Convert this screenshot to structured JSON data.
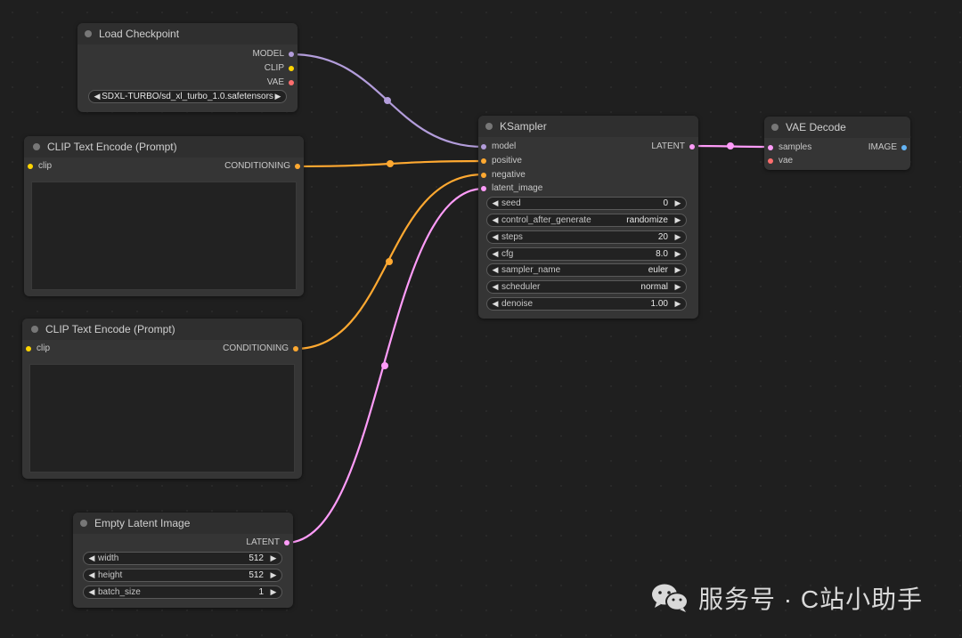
{
  "nodes": {
    "load_checkpoint": {
      "title": "Load Checkpoint",
      "outputs": [
        "MODEL",
        "CLIP",
        "VAE"
      ],
      "ckpt_name": "SDXL-TURBO/sd_xl_turbo_1.0.safetensors"
    },
    "clip_text_encode_1": {
      "title": "CLIP Text Encode (Prompt)",
      "input": "clip",
      "output": "CONDITIONING"
    },
    "clip_text_encode_2": {
      "title": "CLIP Text Encode (Prompt)",
      "input": "clip",
      "output": "CONDITIONING"
    },
    "empty_latent": {
      "title": "Empty Latent Image",
      "output": "LATENT",
      "widgets": [
        {
          "label": "width",
          "value": "512"
        },
        {
          "label": "height",
          "value": "512"
        },
        {
          "label": "batch_size",
          "value": "1"
        }
      ]
    },
    "ksampler": {
      "title": "KSampler",
      "inputs": [
        "model",
        "positive",
        "negative",
        "latent_image"
      ],
      "output": "LATENT",
      "widgets": [
        {
          "label": "seed",
          "value": "0"
        },
        {
          "label": "control_after_generate",
          "value": "randomize"
        },
        {
          "label": "steps",
          "value": "20"
        },
        {
          "label": "cfg",
          "value": "8.0"
        },
        {
          "label": "sampler_name",
          "value": "euler"
        },
        {
          "label": "scheduler",
          "value": "normal"
        },
        {
          "label": "denoise",
          "value": "1.00"
        }
      ]
    },
    "vae_decode": {
      "title": "VAE Decode",
      "inputs": [
        "samples",
        "vae"
      ],
      "output": "IMAGE"
    }
  },
  "arrows": {
    "left": "◀",
    "right": "▶"
  },
  "colors": {
    "model": "#b39ddb",
    "clip": "#ffd500",
    "vae": "#ff6e6e",
    "conditioning": "#ffa931",
    "latent": "#ff9cf9",
    "image": "#64b5f6"
  },
  "watermark": {
    "text": "服务号 · C站小助手",
    "icon": "wechat-icon"
  }
}
